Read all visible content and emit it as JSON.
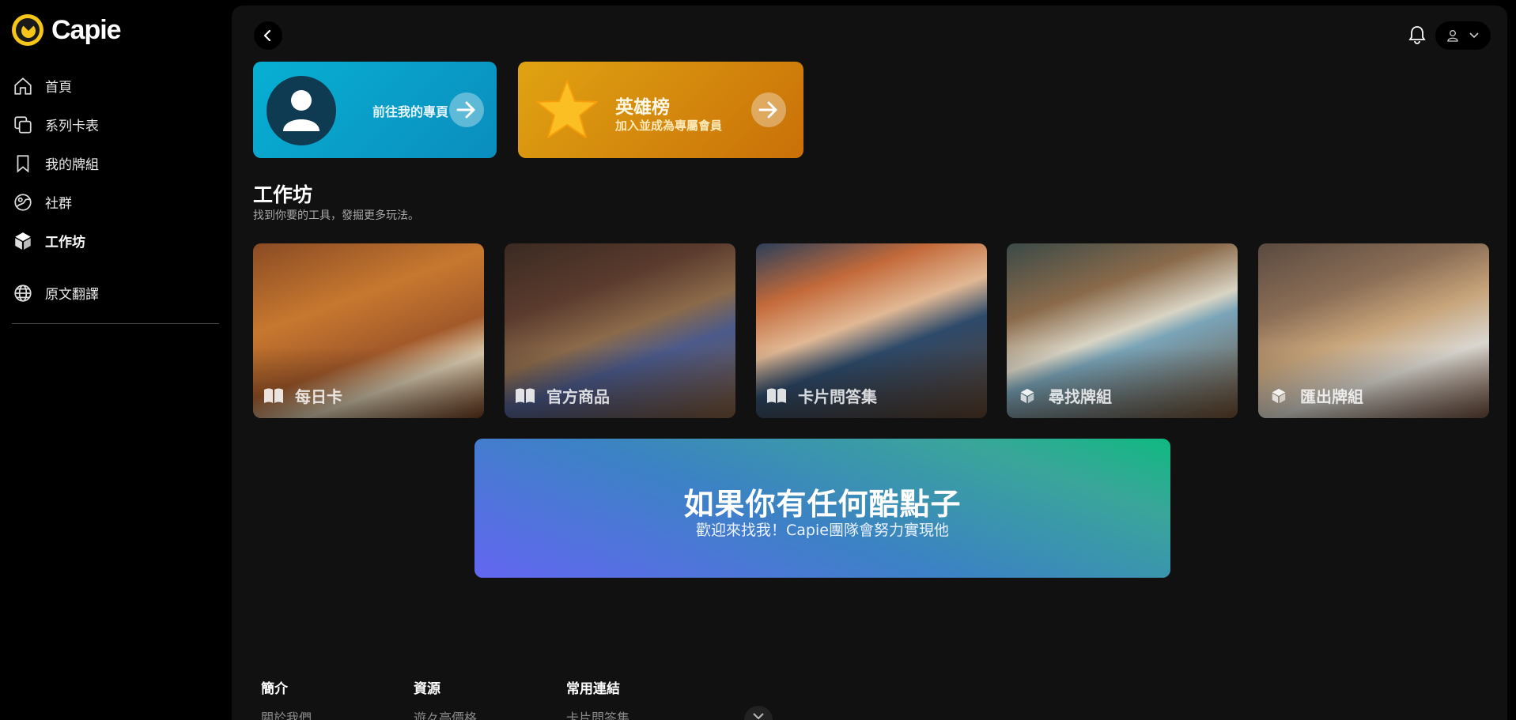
{
  "brand": {
    "name": "Capie"
  },
  "sidebar": {
    "items": [
      {
        "label": "首頁",
        "icon": "home-icon"
      },
      {
        "label": "系列卡表",
        "icon": "copy-cards-icon"
      },
      {
        "label": "我的牌組",
        "icon": "bookmark-icon"
      },
      {
        "label": "社群",
        "icon": "community-icon"
      },
      {
        "label": "工作坊",
        "icon": "cube-icon",
        "active": true
      },
      {
        "label": "原文翻譯",
        "icon": "globe-icon"
      }
    ]
  },
  "header": {
    "notifications_icon": "bell-icon",
    "user_icon": "user-icon"
  },
  "promo": {
    "profile": {
      "label": "前往我的專頁"
    },
    "heroes": {
      "title": "英雄榜",
      "subtitle": "加入並成為專屬會員"
    }
  },
  "workshop": {
    "title": "工作坊",
    "subtitle": "找到你要的工具，發掘更多玩法。",
    "tools": [
      {
        "label": "每日卡",
        "icon": "book-open-icon"
      },
      {
        "label": "官方商品",
        "icon": "book-open-icon"
      },
      {
        "label": "卡片問答集",
        "icon": "book-open-icon"
      },
      {
        "label": "尋找牌組",
        "icon": "cube-icon"
      },
      {
        "label": "匯出牌組",
        "icon": "cube-icon"
      }
    ]
  },
  "cta": {
    "title": "如果你有任何酷點子",
    "subtitle": "歡迎來找我！Capie團隊會努力實現他"
  },
  "footer": {
    "columns": [
      {
        "heading": "簡介",
        "first_link": "關於我們"
      },
      {
        "heading": "資源",
        "first_link": "遊々亭價格"
      },
      {
        "heading": "常用連結",
        "first_link": "卡片問答集"
      }
    ]
  },
  "colors": {
    "sidebar_bg": "#000000",
    "main_bg": "#111111",
    "profile_card": "#0a9fcb",
    "heroes_card": "#d68a0d",
    "cta_start": "#6366f1",
    "cta_end": "#10b981"
  }
}
